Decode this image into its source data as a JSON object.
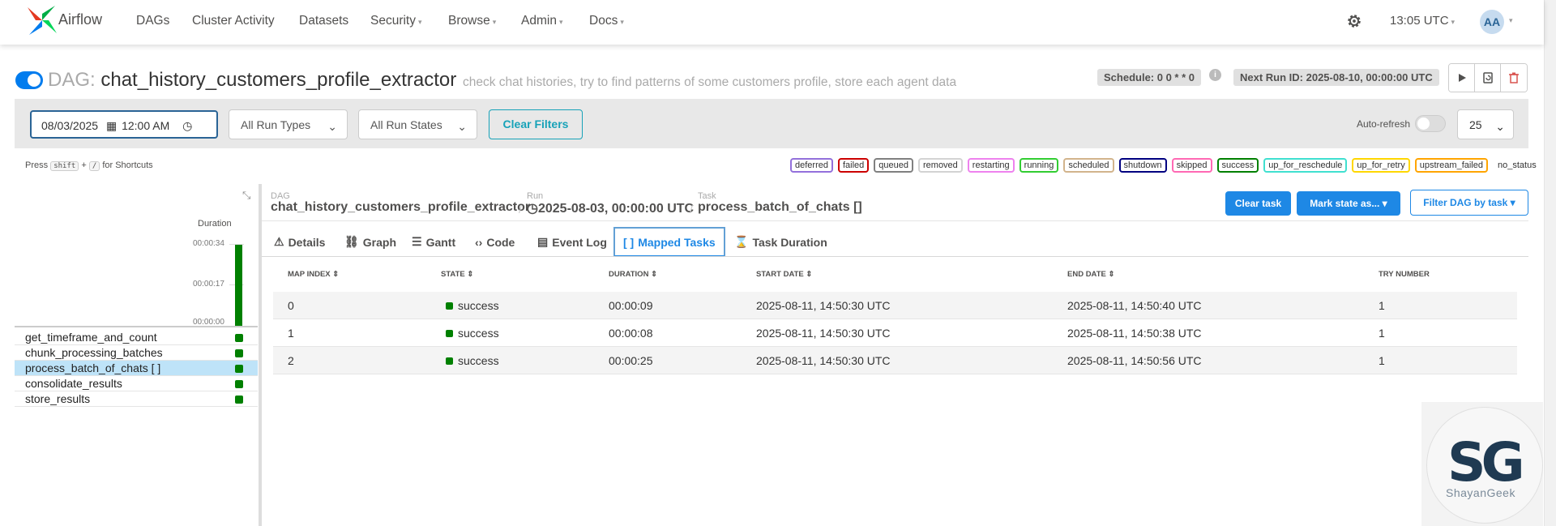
{
  "nav": {
    "brand": "Airflow",
    "items": [
      "DAGs",
      "Cluster Activity",
      "Datasets",
      "Security",
      "Browse",
      "Admin",
      "Docs"
    ],
    "time": "13:05 UTC",
    "avatar": "AA"
  },
  "dag": {
    "prefix": "DAG:",
    "name": "chat_history_customers_profile_extractor",
    "description": "check chat histories, try to find patterns of some customers profile, store each agent data",
    "schedule": "Schedule: 0 0 * * 0",
    "next_run": "Next Run ID: 2025-08-10, 00:00:00 UTC"
  },
  "filters": {
    "date": "08/03/2025",
    "time": "12:00 AM",
    "run_types": "All Run Types",
    "run_states": "All Run States",
    "clear_label": "Clear Filters",
    "autorefresh_label": "Auto-refresh",
    "page_size": "25"
  },
  "shortcuts": {
    "press": "Press",
    "key1": "shift",
    "plus": "+",
    "key2": "/",
    "suffix": "for Shortcuts"
  },
  "legend": [
    {
      "label": "deferred",
      "color": "#9370db"
    },
    {
      "label": "failed",
      "color": "#cc0000"
    },
    {
      "label": "queued",
      "color": "#808080"
    },
    {
      "label": "removed",
      "color": "#d3d3d3"
    },
    {
      "label": "restarting",
      "color": "#ee82ee"
    },
    {
      "label": "running",
      "color": "#32cd32"
    },
    {
      "label": "scheduled",
      "color": "#d2b48c"
    },
    {
      "label": "shutdown",
      "color": "#000080"
    },
    {
      "label": "skipped",
      "color": "#ff69b4"
    },
    {
      "label": "success",
      "color": "#008000"
    },
    {
      "label": "up_for_reschedule",
      "color": "#40e0d0"
    },
    {
      "label": "up_for_retry",
      "color": "#ffd700"
    },
    {
      "label": "upstream_failed",
      "color": "#ffa500"
    },
    {
      "label": "no_status",
      "color": "#ffffff"
    }
  ],
  "grid": {
    "duration_label": "Duration",
    "ticks": [
      "00:00:34",
      "00:00:17",
      "00:00:00"
    ],
    "tasks": [
      {
        "name": "get_timeframe_and_count",
        "status": "success"
      },
      {
        "name": "chunk_processing_batches",
        "status": "success"
      },
      {
        "name": "process_batch_of_chats [ ]",
        "status": "success"
      },
      {
        "name": "consolidate_results",
        "status": "success"
      },
      {
        "name": "store_results",
        "status": "success"
      }
    ]
  },
  "breadcrumb": {
    "dag_label": "DAG",
    "dag_value": "chat_history_customers_profile_extractor",
    "run_label": "Run",
    "run_value": "2025-08-03, 00:00:00 UTC",
    "task_label": "Task",
    "task_value": "process_batch_of_chats []"
  },
  "task_actions": {
    "clear": "Clear task",
    "mark": "Mark state as...",
    "filter": "Filter DAG by task"
  },
  "tabs": [
    "Details",
    "Graph",
    "Gantt",
    "Code",
    "Event Log",
    "Mapped Tasks",
    "Task Duration"
  ],
  "table": {
    "headers": [
      "MAP INDEX",
      "STATE",
      "DURATION",
      "START DATE",
      "END DATE",
      "TRY NUMBER"
    ],
    "rows": [
      {
        "map_index": "0",
        "state": "success",
        "duration": "00:00:09",
        "start": "2025-08-11, 14:50:30 UTC",
        "end": "2025-08-11, 14:50:40 UTC",
        "try": "1"
      },
      {
        "map_index": "1",
        "state": "success",
        "duration": "00:00:08",
        "start": "2025-08-11, 14:50:30 UTC",
        "end": "2025-08-11, 14:50:38 UTC",
        "try": "1"
      },
      {
        "map_index": "2",
        "state": "success",
        "duration": "00:00:25",
        "start": "2025-08-11, 14:50:30 UTC",
        "end": "2025-08-11, 14:50:56 UTC",
        "try": "1"
      }
    ]
  },
  "watermark": {
    "logo": "SG",
    "text": "ShayanGeek"
  }
}
